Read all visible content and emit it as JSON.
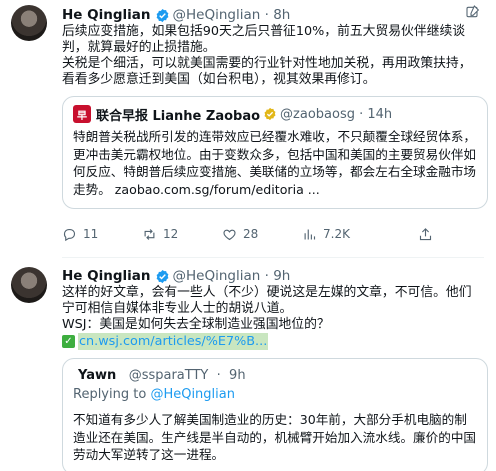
{
  "tweets": [
    {
      "author": "He Qinglian",
      "handle": "@HeQinglian",
      "time": "8h",
      "lines": [
        "后续应变措施，如果包括90天之后只普征10%，前五大贸易伙伴继续谈判，就算最好的止损措施。",
        "关税是个细活，可以就美国需要的行业针对性地加关税，再用政策扶持，看看多少愿意迁到美国（如台积电），视其效果再修订。"
      ],
      "quote": {
        "logo": "早",
        "name": "联合早报 Lianhe Zaobao",
        "handle": "@zaobaosg",
        "time": "14h",
        "text": "特朗普关税战所引发的连带效应已经覆水难收，不只颠覆全球经贸体系，更冲击美元霸权地位。由于变数众多，包括中国和美国的主要贸易伙伴如何反应、特朗普后续应变措施、美联储的立场等，都会左右全球金融市场走势。 zaobao.com.sg/forum/editoria ..."
      },
      "actions": {
        "replies": "11",
        "retweets": "12",
        "likes": "28",
        "views": "7.2K"
      }
    },
    {
      "author": "He Qinglian",
      "handle": "@HeQinglian",
      "time": "9h",
      "lines": [
        "这样的好文章，会有一些人（不少）硬说这是左媒的文章，不可信。他们宁可相信自媒体非专业人士的胡说八道。",
        "WSJ：美国是如何失去全球制造业强国地位的？"
      ],
      "link": "cn.wsj.com/articles/%E7%B...",
      "quote": {
        "name": "Yawn",
        "handle": "@ssparaTTY",
        "time": "9h",
        "replying_label": "Replying to",
        "replying_to": "@HeQinglian",
        "text": "不知道有多少人了解美国制造业的历史：30年前，大部分手机电脑的制造业还在美国。生产线是半自动的，机械臂开始加入流水线。廉价的中国劳动大军逆转了这一进程。"
      }
    }
  ],
  "colors": {
    "accent": "#1d9bf0",
    "muted": "#536471",
    "border": "#cfd9de"
  },
  "icons": [
    "verified-badge-icon",
    "gold-verified-icon",
    "more-icon",
    "reply-icon",
    "retweet-icon",
    "like-icon",
    "views-icon",
    "share-icon",
    "check-emoji-icon"
  ]
}
